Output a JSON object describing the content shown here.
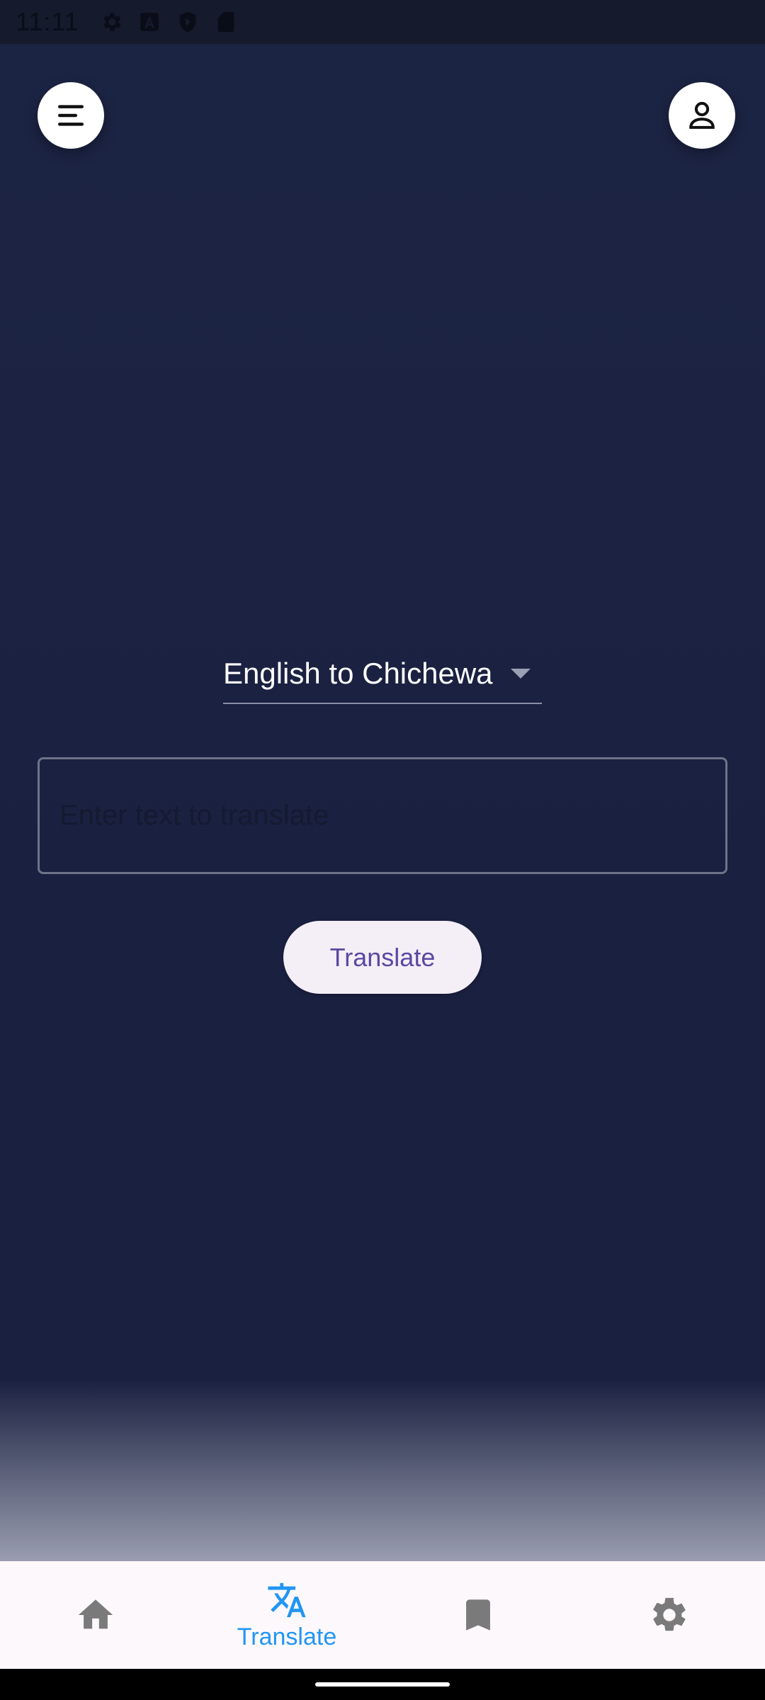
{
  "status_bar": {
    "time": "11:11"
  },
  "language_selector": {
    "selected": "English to Chichewa"
  },
  "input": {
    "placeholder": "Enter text to translate",
    "value": ""
  },
  "actions": {
    "translate_label": "Translate"
  },
  "bottom_nav": {
    "items": [
      {
        "icon": "home-icon",
        "label": "",
        "active": false
      },
      {
        "icon": "translate-icon",
        "label": "Translate",
        "active": true
      },
      {
        "icon": "bookmark-icon",
        "label": "",
        "active": false
      },
      {
        "icon": "gear-icon",
        "label": "",
        "active": false
      }
    ]
  },
  "colors": {
    "background": "#1a2040",
    "accent": "#2196f3",
    "button_text": "#5b47a0",
    "nav_inactive": "#7a7a7a"
  }
}
